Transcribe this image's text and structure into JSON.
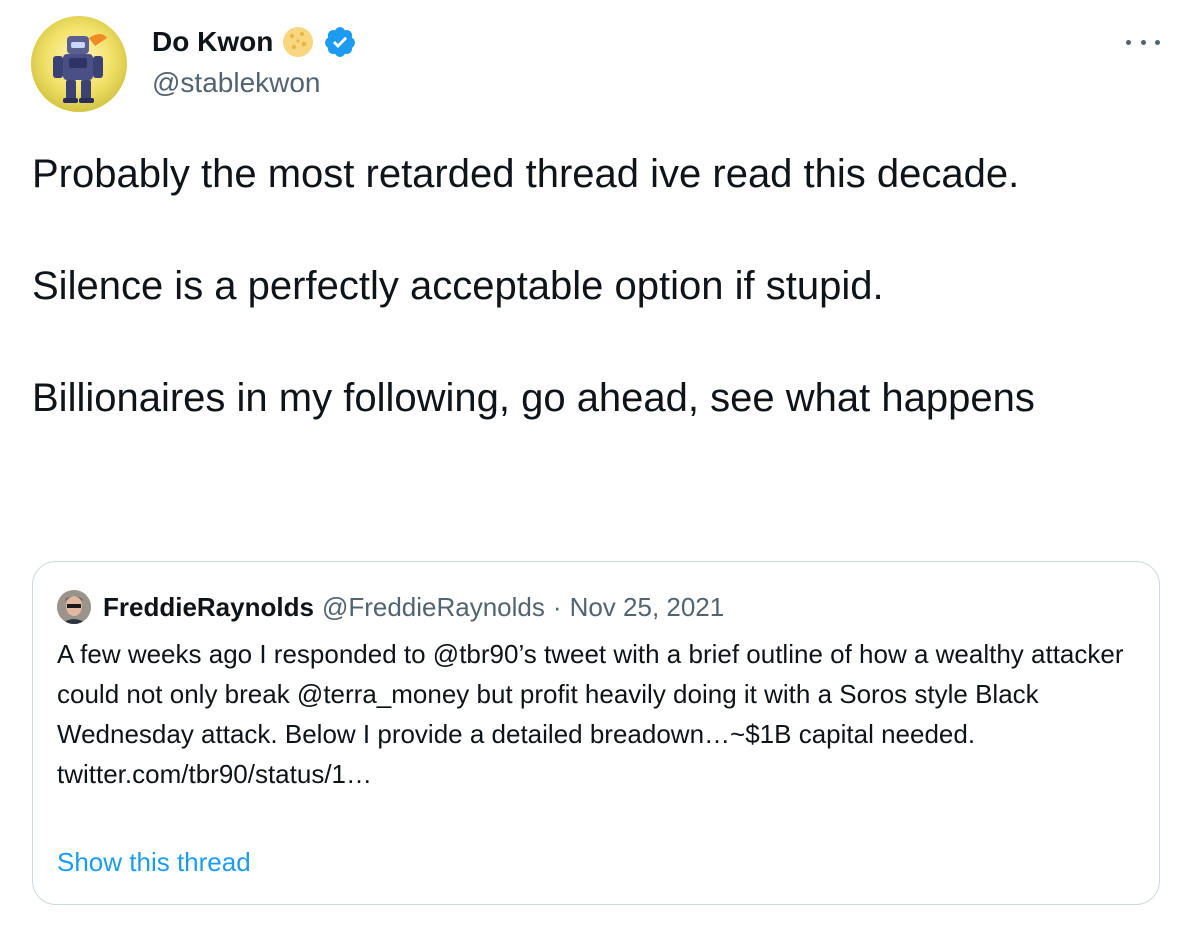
{
  "author": {
    "display_name": "Do Kwon",
    "handle": "@stablekwon",
    "avatar_icon": "robot-avatar",
    "name_emoji_icon": "cookie-icon",
    "verified_icon": "verified-badge-icon"
  },
  "more_icon": "more-options-icon",
  "tweet": {
    "paragraphs": [
      "Probably the most retarded thread ive read this decade.",
      "Silence is a perfectly acceptable option if stupid.",
      "Billionaires in my following, go ahead, see what happens"
    ]
  },
  "quote": {
    "display_name": "FreddieRaynolds",
    "handle": "@FreddieRaynolds",
    "separator": "·",
    "date": "Nov 25, 2021",
    "body": "A few weeks ago I responded to @tbr90’s tweet with a brief outline of how a wealthy attacker could not only break @terra_money but profit heavily doing it with a Soros style Black Wednesday attack. Below I provide a detailed breadown…~$1B capital needed.",
    "link": "twitter.com/tbr90/status/1…",
    "show_thread": "Show this thread"
  },
  "colors": {
    "text": "#0f1419",
    "secondary": "#536471",
    "link": "#1d9bf0",
    "border": "#cfd9de",
    "verified": "#1d9bf0"
  }
}
